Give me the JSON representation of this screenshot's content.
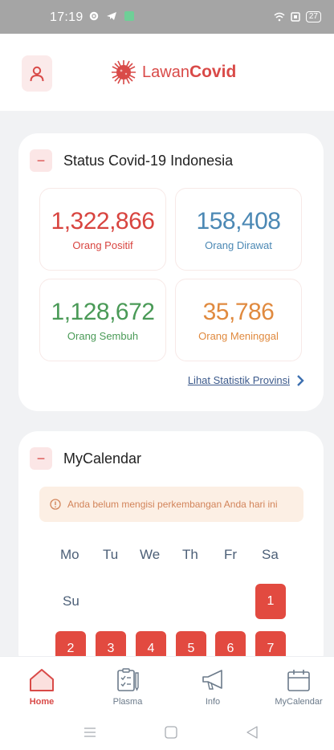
{
  "status_bar": {
    "time": "17:19",
    "battery": "27"
  },
  "header": {
    "logo_text_light": "Lawan",
    "logo_text_bold": "Covid"
  },
  "status_card": {
    "title": "Status Covid-19 Indonesia",
    "collapse_symbol": "−",
    "stats": [
      {
        "value": "1,322,866",
        "label": "Orang Positif",
        "color": "#d8443f"
      },
      {
        "value": "158,408",
        "label": "Orang Dirawat",
        "color": "#4b88b4"
      },
      {
        "value": "1,128,672",
        "label": "Orang Sembuh",
        "color": "#4a9a57"
      },
      {
        "value": "35,786",
        "label": "Orang Meninggal",
        "color": "#e08a3f"
      }
    ],
    "link": "Lihat Statistik Provinsi"
  },
  "calendar_card": {
    "title": "MyCalendar",
    "collapse_symbol": "−",
    "alert": "Anda belum mengisi perkembangan Anda hari ini",
    "weekdays": [
      "Mo",
      "Tu",
      "We",
      "Th",
      "Fr",
      "Sa",
      "Su"
    ],
    "days": [
      "1",
      "2",
      "3",
      "4",
      "5",
      "6",
      "7"
    ]
  },
  "bottom_nav": [
    {
      "label": "Home",
      "icon": "home-icon",
      "active": true
    },
    {
      "label": "Plasma",
      "icon": "clipboard-icon",
      "active": false
    },
    {
      "label": "Info",
      "icon": "megaphone-icon",
      "active": false
    },
    {
      "label": "MyCalendar",
      "icon": "calendar-icon",
      "active": false
    }
  ],
  "colors": {
    "brand": "#d94a48",
    "day_fill": "#e24a40",
    "link": "#3c5a8c"
  }
}
